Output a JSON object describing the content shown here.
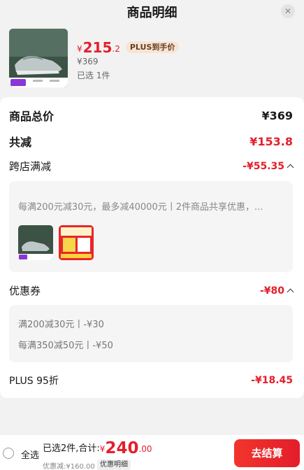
{
  "header": {
    "title": "商品明细",
    "close_icon": "close-icon"
  },
  "product": {
    "price_symbol": "¥",
    "price_int": "215",
    "price_dec": ".2",
    "plus_tag": "PLUS到手价",
    "original_price": "¥369",
    "selected_count": "已选 1件"
  },
  "breakdown": {
    "total": {
      "label": "商品总价",
      "value": "¥369"
    },
    "reduction": {
      "label": "共减",
      "value": "¥153.8"
    },
    "cross_store": {
      "label": "跨店满减",
      "value": "-¥55.35",
      "description": "每满200元减30元，最多减40000元丨2件商品共享优惠，..."
    },
    "coupon": {
      "label": "优惠券",
      "value": "-¥80",
      "lines": [
        "满200减30元丨-¥30",
        "每满350减50元丨-¥50"
      ]
    },
    "plus": {
      "label": "PLUS 95折",
      "value": "-¥18.45"
    }
  },
  "footer": {
    "select_all": "全选",
    "summary_label": "已选2件,合计:",
    "currency": "¥",
    "total_int": "240",
    "total_dec": ".00",
    "discount_note": "优惠减:¥160.00",
    "detail_label": "优惠明细",
    "checkout_label": "去结算"
  },
  "colors": {
    "accent_red": "#e3202c",
    "plus_tag_bg": "#f6e5d7"
  }
}
